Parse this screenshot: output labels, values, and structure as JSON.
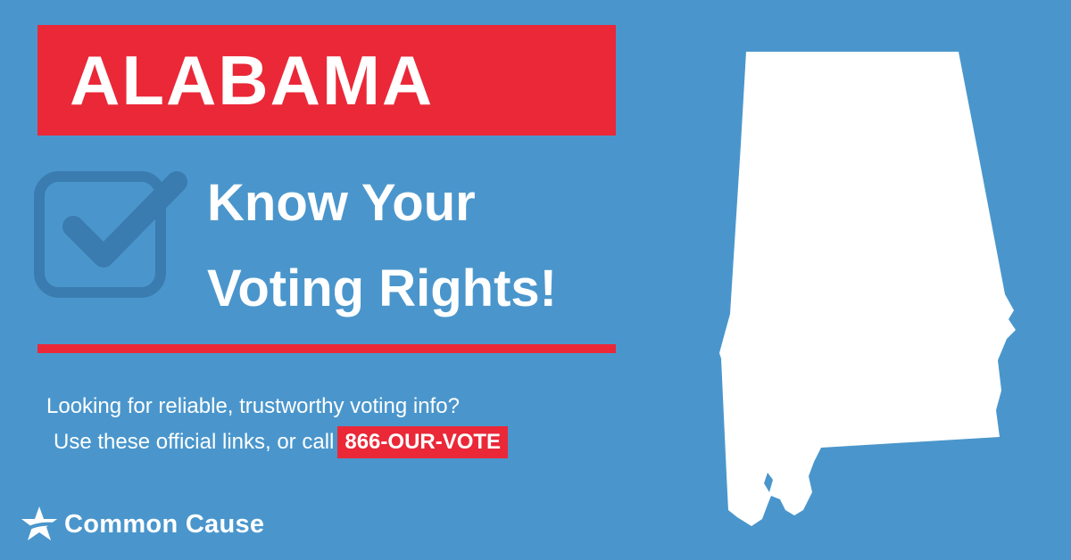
{
  "banner": {
    "title": "ALABAMA",
    "color": "#ea2838"
  },
  "headline": {
    "line1": "Know Your",
    "line2": "Voting Rights!"
  },
  "info": {
    "line1": "Looking for reliable, trustworthy voting info?",
    "line2": "Use these official links, or call",
    "phone": "866-OUR-VOTE"
  },
  "logo": {
    "icon": "star-icon",
    "name": "Common Cause"
  },
  "icons": {
    "checkbox": "checkbox-checked-icon",
    "map": "alabama-state-map"
  },
  "colors": {
    "background": "#4a96cc",
    "accent": "#ea2838",
    "icon": "#3a7cb0"
  }
}
